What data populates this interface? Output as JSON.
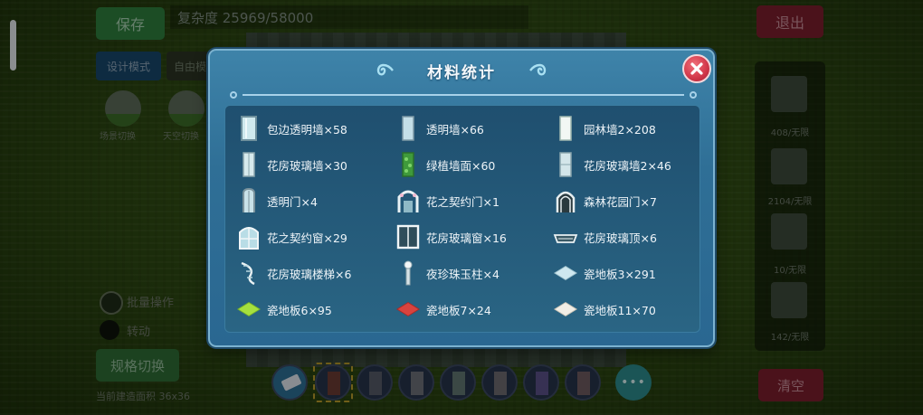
{
  "background": {
    "save_label": "保存",
    "complexity": "复杂度 25969/58000",
    "exit_label": "退出",
    "mode_label": "设计模式",
    "mode2_label": "自由模",
    "scene1_label": "场景切换",
    "scene2_label": "天空切换",
    "batch_label": "批量操作",
    "rotate_label": "转动",
    "switch_label": "规格切换",
    "area_label": "当前建造面积 36x36",
    "clear_label": "清空",
    "right_items": [
      "408/无限",
      "2104/无限",
      "10/无限",
      "142/无限"
    ],
    "more_label": "•••"
  },
  "dialog": {
    "title": "材料统计",
    "items": [
      {
        "label": "包边透明墙×58",
        "icon": "glass-wall-icon"
      },
      {
        "label": "透明墙×66",
        "icon": "glass-panel-icon"
      },
      {
        "label": "园林墙2×208",
        "icon": "garden-wall-icon"
      },
      {
        "label": "花房玻璃墙×30",
        "icon": "greenhouse-wall-icon"
      },
      {
        "label": "绿植墙面×60",
        "icon": "plant-wall-icon"
      },
      {
        "label": "花房玻璃墙2×46",
        "icon": "greenhouse-wall2-icon"
      },
      {
        "label": "透明门×4",
        "icon": "glass-door-icon"
      },
      {
        "label": "花之契约门×1",
        "icon": "flower-arch-door-icon"
      },
      {
        "label": "森林花园门×7",
        "icon": "forest-gate-icon"
      },
      {
        "label": "花之契约窗×29",
        "icon": "flower-window-icon"
      },
      {
        "label": "花房玻璃窗×16",
        "icon": "greenhouse-window-icon"
      },
      {
        "label": "花房玻璃顶×6",
        "icon": "greenhouse-roof-icon"
      },
      {
        "label": "花房玻璃楼梯×6",
        "icon": "glass-stairs-icon"
      },
      {
        "label": "夜珍珠玉柱×4",
        "icon": "pearl-pillar-icon"
      },
      {
        "label": "瓷地板3×291",
        "icon": "tile-floor-light-blue-icon"
      },
      {
        "label": "瓷地板6×95",
        "icon": "tile-floor-green-icon"
      },
      {
        "label": "瓷地板7×24",
        "icon": "tile-floor-red-icon"
      },
      {
        "label": "瓷地板11×70",
        "icon": "tile-floor-white-icon"
      }
    ]
  }
}
